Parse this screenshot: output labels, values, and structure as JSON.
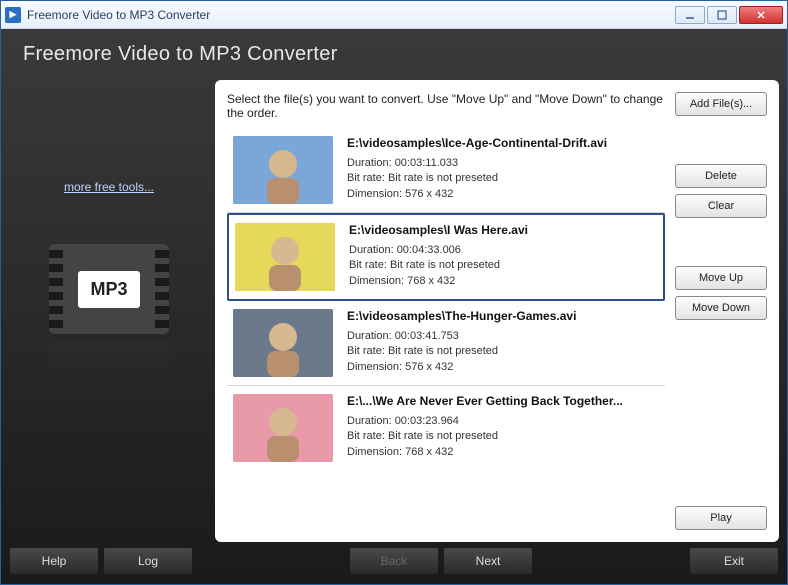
{
  "window": {
    "title": "Freemore Video to MP3 Converter"
  },
  "header": {
    "title": "Freemore Video to MP3 Converter"
  },
  "sidebar": {
    "more_link": "more free tools...",
    "icon_label": "MP3"
  },
  "content": {
    "instruction": "Select the file(s) you want to convert. Use \"Move Up\" and \"Move Down\" to change the order.",
    "files": [
      {
        "path": "E:\\videosamples\\Ice-Age-Continental-Drift.avi",
        "duration": "Duration: 00:03:11.033",
        "bitrate": "Bit rate: Bit rate is not preseted",
        "dimension": "Dimension: 576 x 432",
        "selected": false
      },
      {
        "path": "E:\\videosamples\\I Was Here.avi",
        "duration": "Duration: 00:04:33.006",
        "bitrate": "Bit rate: Bit rate is not preseted",
        "dimension": "Dimension: 768 x 432",
        "selected": true
      },
      {
        "path": "E:\\videosamples\\The-Hunger-Games.avi",
        "duration": "Duration: 00:03:41.753",
        "bitrate": "Bit rate: Bit rate is not preseted",
        "dimension": "Dimension: 576 x 432",
        "selected": false
      },
      {
        "path": "E:\\...\\We Are Never Ever Getting Back Together...",
        "duration": "Duration: 00:03:23.964",
        "bitrate": "Bit rate: Bit rate is not preseted",
        "dimension": "Dimension: 768 x 432",
        "selected": false
      }
    ]
  },
  "buttons": {
    "add": "Add File(s)...",
    "delete": "Delete",
    "clear": "Clear",
    "moveup": "Move Up",
    "movedown": "Move Down",
    "play": "Play"
  },
  "footer": {
    "help": "Help",
    "log": "Log",
    "back": "Back",
    "next": "Next",
    "exit": "Exit"
  },
  "thumbs": {
    "colors": [
      "#7aa6d8",
      "#e6d85a",
      "#6b7a8a",
      "#e89aa8"
    ]
  }
}
